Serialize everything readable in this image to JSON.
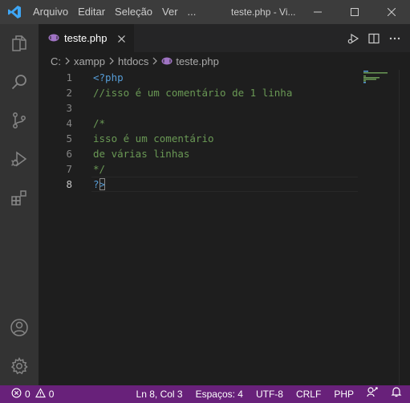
{
  "titlebar": {
    "menu": [
      "Arquivo",
      "Editar",
      "Seleção",
      "Ver",
      "..."
    ],
    "title": "teste.php - Vi..."
  },
  "tab": {
    "label": "teste.php"
  },
  "breadcrumb": {
    "drive": "C:",
    "folder1": "xampp",
    "folder2": "htdocs",
    "file": "teste.php"
  },
  "editor": {
    "line_numbers": [
      "1",
      "2",
      "3",
      "4",
      "5",
      "6",
      "7",
      "8"
    ],
    "line1_tag": "<?php",
    "line2": "//isso é um comentário de 1 linha",
    "line4": "/*",
    "line5": "isso é um comentário",
    "line6": "de várias linhas",
    "line7": "*/",
    "line8_a": "?",
    "line8_b": ">"
  },
  "status": {
    "errors": "0",
    "warnings": "0",
    "position": "Ln 8, Col 3",
    "spaces": "Espaços: 4",
    "encoding": "UTF-8",
    "eol": "CRLF",
    "language": "PHP"
  },
  "colors": {
    "statusbar": "#68217a",
    "titlebar": "#3c3c3c",
    "activitybar": "#333333",
    "editor_bg": "#1e1e1e",
    "comment": "#6a9955",
    "php_tag": "#569cd6",
    "vscode_logo": "#3ea6f5"
  },
  "icons": {
    "activity": [
      "explorer-icon",
      "search-icon",
      "source-control-icon",
      "run-debug-icon",
      "extensions-icon",
      "account-icon",
      "settings-gear-icon"
    ],
    "editor_actions": [
      "run-debug-icon",
      "split-editor-icon",
      "more-actions-icon"
    ],
    "status_right": [
      "feedback-icon",
      "notifications-icon"
    ]
  }
}
